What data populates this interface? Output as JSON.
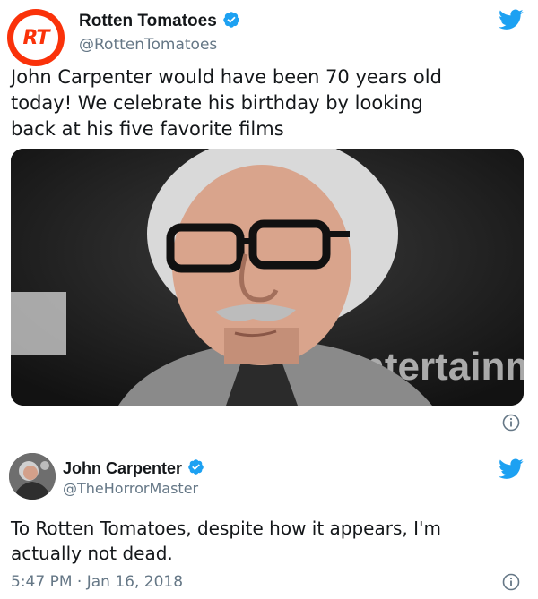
{
  "tweet1": {
    "avatar_text": "RT",
    "display_name": "Rotten Tomatoes",
    "handle": "@RottenTomatoes",
    "text_lines": [
      "John Carpenter would have been 70 years old",
      "today! We celebrate his birthday by looking",
      "back at his five favorite films"
    ],
    "media_icon": "photo-of-elderly-man-with-glasses",
    "media_backdrop_text": "ntertainment"
  },
  "tweet2": {
    "display_name": "John Carpenter",
    "handle": "@TheHorrorMaster",
    "text_lines": [
      "To Rotten Tomatoes, despite how it appears, I'm",
      "actually not dead."
    ],
    "timestamp": "5:47 PM · Jan 16, 2018"
  },
  "colors": {
    "twitter_blue": "#1da1f2",
    "rt_red": "#fa320a",
    "handle_gray": "#657786"
  },
  "icons": {
    "verified": "verified-badge-icon",
    "bird": "twitter-bird-icon",
    "info": "info-icon"
  }
}
